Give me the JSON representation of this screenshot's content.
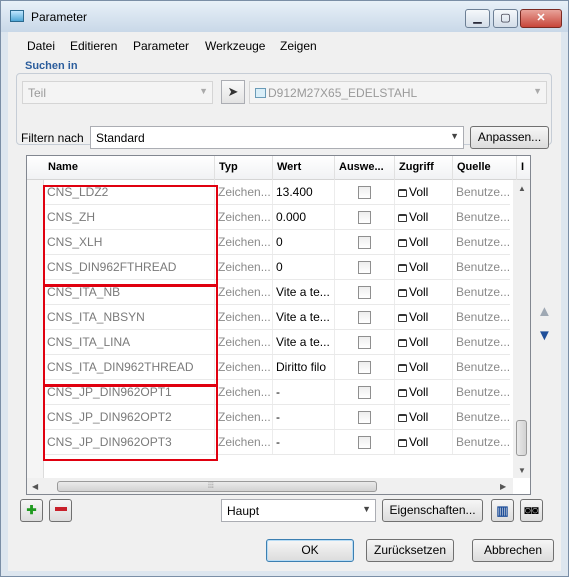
{
  "window": {
    "title": "Parameter"
  },
  "menu": [
    "Datei",
    "Editieren",
    "Parameter",
    "Werkzeuge",
    "Zeigen"
  ],
  "search": {
    "legend": "Suchen in",
    "scope_value": "Teil",
    "part_value": "D912M27X65_EDELSTAHL"
  },
  "filter": {
    "label": "Filtern nach",
    "value": "Standard",
    "adjust_button": "Anpassen..."
  },
  "table": {
    "columns": [
      "Name",
      "Typ",
      "Wert",
      "Auswe...",
      "Zugriff",
      "Quelle",
      "I"
    ],
    "rows": [
      {
        "name": "CNS_LDZ2",
        "typ": "Zeichen...",
        "wert": "13.400",
        "zugriff": "Voll",
        "quelle": "Benutze..."
      },
      {
        "name": "CNS_ZH",
        "typ": "Zeichen...",
        "wert": "0.000",
        "zugriff": "Voll",
        "quelle": "Benutze..."
      },
      {
        "name": "CNS_XLH",
        "typ": "Zeichen...",
        "wert": "0",
        "zugriff": "Voll",
        "quelle": "Benutze..."
      },
      {
        "name": "CNS_DIN962FTHREAD",
        "typ": "Zeichen...",
        "wert": "0",
        "zugriff": "Voll",
        "quelle": "Benutze..."
      },
      {
        "name": "CNS_ITA_NB",
        "typ": "Zeichen...",
        "wert": "Vite a te...",
        "zugriff": "Voll",
        "quelle": "Benutze..."
      },
      {
        "name": "CNS_ITA_NBSYN",
        "typ": "Zeichen...",
        "wert": "Vite a te...",
        "zugriff": "Voll",
        "quelle": "Benutze..."
      },
      {
        "name": "CNS_ITA_LINA",
        "typ": "Zeichen...",
        "wert": "Vite a te...",
        "zugriff": "Voll",
        "quelle": "Benutze..."
      },
      {
        "name": "CNS_ITA_DIN962THREAD",
        "typ": "Zeichen...",
        "wert": "Diritto filo",
        "zugriff": "Voll",
        "quelle": "Benutze..."
      },
      {
        "name": "CNS_JP_DIN962OPT1",
        "typ": "Zeichen...",
        "wert": "-",
        "zugriff": "Voll",
        "quelle": "Benutze..."
      },
      {
        "name": "CNS_JP_DIN962OPT2",
        "typ": "Zeichen...",
        "wert": "-",
        "zugriff": "Voll",
        "quelle": "Benutze..."
      },
      {
        "name": "CNS_JP_DIN962OPT3",
        "typ": "Zeichen...",
        "wert": "-",
        "zugriff": "Voll",
        "quelle": "Benutze..."
      }
    ]
  },
  "bottom": {
    "view_value": "Haupt",
    "properties_button": "Eigenschaften...",
    "ok": "OK",
    "reset": "Zurücksetzen",
    "cancel": "Abbrechen"
  },
  "icons": {
    "add": "plus-icon",
    "remove": "minus-icon",
    "columns": "columns-icon",
    "find": "binoculars-icon",
    "lock": "lock-icon"
  },
  "colors": {
    "highlight_box": "#e0000f",
    "accent": "#2b5d9c"
  }
}
